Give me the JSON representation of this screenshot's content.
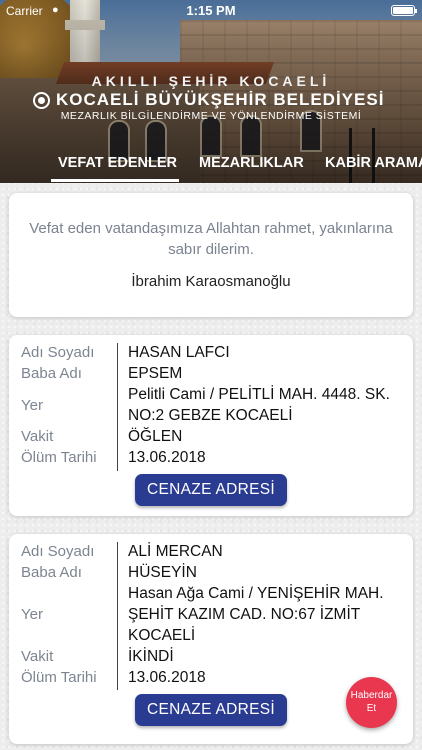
{
  "status_bar": {
    "carrier": "Carrier",
    "time": "1:15 PM"
  },
  "brand": {
    "tagline": "AKILLI ŞEHİR KOCAELİ",
    "name": "KOCAELİ BÜYÜKŞEHİR BELEDİYESİ",
    "subtitle": "MEZARLIK BİLGİLENDİRME VE YÖNLENDİRME SİSTEMİ"
  },
  "tabs": [
    {
      "label": "VEFAT EDENLER",
      "active": true
    },
    {
      "label": "MEZARLIKLAR",
      "active": false
    },
    {
      "label": "KABİR ARAMA",
      "active": false
    }
  ],
  "condolence": {
    "message": "Vefat eden vatandaşımıza Allahtan rahmet, yakınlarına sabır dilerim.",
    "signature": "İbrahim Karaosmanoğlu"
  },
  "labels": {
    "name": "Adı Soyadı",
    "father": "Baba Adı",
    "place": "Yer",
    "time": "Vakit",
    "date": "Ölüm Tarihi"
  },
  "records": [
    {
      "name": "HASAN LAFCI",
      "father": "EPSEM",
      "place": "Pelitli Cami / PELİTLİ MAH. 4448. SK. NO:2 GEBZE KOCAELİ",
      "time": "ÖĞLEN",
      "date": "13.06.2018",
      "button": "CENAZE ADRESİ"
    },
    {
      "name": "ALİ MERCAN",
      "father": "HÜSEYİN",
      "place": "Hasan Ağa Cami / YENİŞEHİR MAH. ŞEHİT KAZIM CAD. NO:67 İZMİT KOCAELİ",
      "time": "İKİNDİ",
      "date": "13.06.2018",
      "button": "CENAZE ADRESİ"
    }
  ],
  "fab": {
    "label": "Haberdar Et"
  },
  "colors": {
    "primary_button": "#2a3b92",
    "fab": "#e8374e",
    "label_gray": "#7d8591"
  }
}
